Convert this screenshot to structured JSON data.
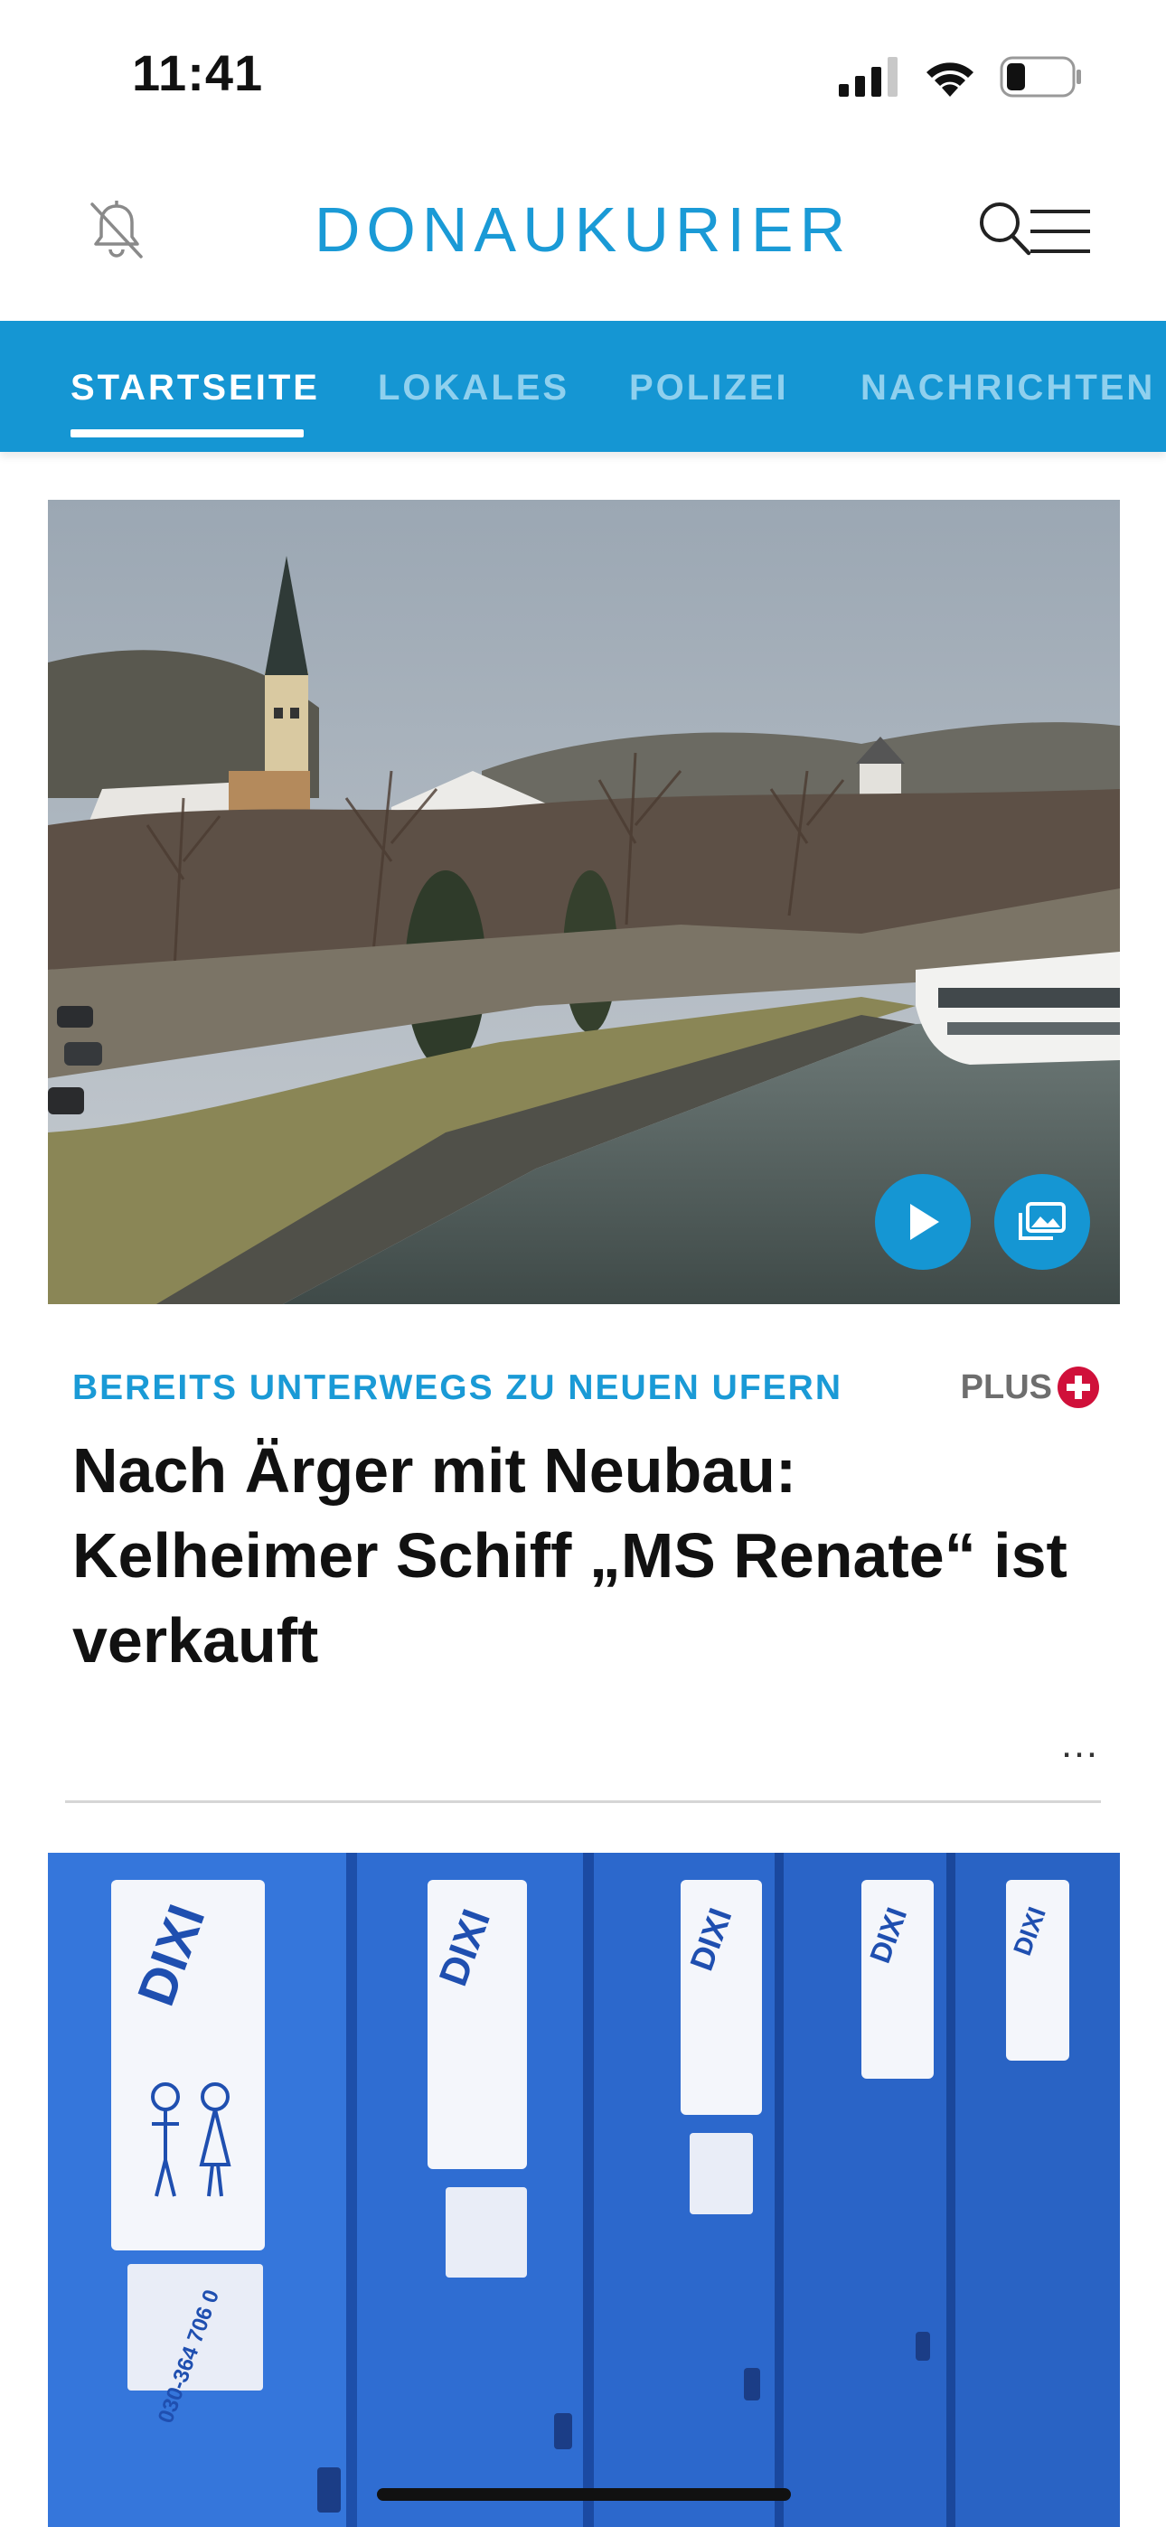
{
  "status_bar": {
    "time": "11:41"
  },
  "header": {
    "brand": "DONAUKURIER"
  },
  "nav": {
    "tabs": [
      {
        "label": "STARTSEITE",
        "active": true
      },
      {
        "label": "LOKALES",
        "active": false
      },
      {
        "label": "POLIZEI",
        "active": false
      },
      {
        "label": "NACHRICHTEN",
        "active": false
      }
    ]
  },
  "article1": {
    "kicker": "BEREITS UNTERWEGS ZU NEUEN UFERN",
    "badge": "PLUS",
    "headline": "Nach Ärger mit Neubau: Kelheimer Schiff „MS Renate“ ist verkauft",
    "more": "…"
  },
  "article2": {
    "image_text": {
      "brand": "DIXI",
      "phone": "030-364 706 0"
    }
  },
  "colors": {
    "accent": "#1596d3",
    "plus_red": "#d0103a"
  }
}
